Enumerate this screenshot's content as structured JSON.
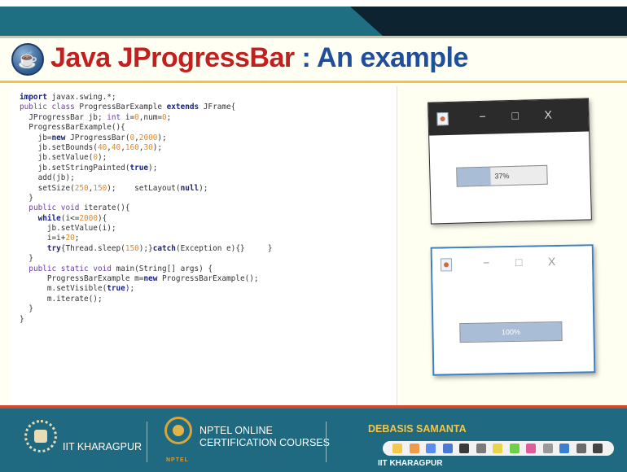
{
  "slide": {
    "title_part1": "Java JProgressBar",
    "title_part2": " : An example"
  },
  "code_lines": [
    [
      {
        "t": "import",
        "c": "kw"
      },
      {
        "t": " javax.swing.*;"
      }
    ],
    [
      {
        "t": "public class",
        "c": "kp"
      },
      {
        "t": " ProgressBarExample "
      },
      {
        "t": "extends",
        "c": "kw"
      },
      {
        "t": " JFrame{"
      }
    ],
    [
      {
        "t": "  JProgressBar jb; "
      },
      {
        "t": "int",
        "c": "kp"
      },
      {
        "t": " i="
      },
      {
        "t": "0",
        "c": "num"
      },
      {
        "t": ",num="
      },
      {
        "t": "0",
        "c": "num"
      },
      {
        "t": ";"
      }
    ],
    [
      {
        "t": "  ProgressBarExample(){"
      }
    ],
    [
      {
        "t": "    jb="
      },
      {
        "t": "new",
        "c": "kw"
      },
      {
        "t": " JProgressBar("
      },
      {
        "t": "0",
        "c": "num"
      },
      {
        "t": ","
      },
      {
        "t": "2000",
        "c": "num"
      },
      {
        "t": ");"
      }
    ],
    [
      {
        "t": "    jb.setBounds("
      },
      {
        "t": "40",
        "c": "num"
      },
      {
        "t": ","
      },
      {
        "t": "40",
        "c": "num"
      },
      {
        "t": ","
      },
      {
        "t": "160",
        "c": "num"
      },
      {
        "t": ","
      },
      {
        "t": "30",
        "c": "num"
      },
      {
        "t": ");"
      }
    ],
    [
      {
        "t": "    jb.setValue("
      },
      {
        "t": "0",
        "c": "num"
      },
      {
        "t": ");"
      }
    ],
    [
      {
        "t": "    jb.setStringPainted("
      },
      {
        "t": "true",
        "c": "kw"
      },
      {
        "t": ");"
      }
    ],
    [
      {
        "t": "    add(jb);"
      }
    ],
    [
      {
        "t": "    setSize("
      },
      {
        "t": "250",
        "c": "num"
      },
      {
        "t": ","
      },
      {
        "t": "150",
        "c": "num"
      },
      {
        "t": ");    setLayout("
      },
      {
        "t": "null",
        "c": "kw"
      },
      {
        "t": ");"
      }
    ],
    [
      {
        "t": "  }"
      }
    ],
    [
      {
        "t": "  "
      },
      {
        "t": "public void",
        "c": "kp"
      },
      {
        "t": " iterate(){"
      }
    ],
    [
      {
        "t": "    "
      },
      {
        "t": "while",
        "c": "kw"
      },
      {
        "t": "(i<="
      },
      {
        "t": "2000",
        "c": "num"
      },
      {
        "t": "){"
      }
    ],
    [
      {
        "t": "      jb.setValue(i);"
      }
    ],
    [
      {
        "t": "      i=i+"
      },
      {
        "t": "20",
        "c": "num"
      },
      {
        "t": ";"
      }
    ],
    [
      {
        "t": "      "
      },
      {
        "t": "try",
        "c": "kw"
      },
      {
        "t": "{Thread.sleep("
      },
      {
        "t": "150",
        "c": "num"
      },
      {
        "t": ");}"
      },
      {
        "t": "catch",
        "c": "kw"
      },
      {
        "t": "(Exception e){}     }"
      }
    ],
    [
      {
        "t": "  }"
      }
    ],
    [
      {
        "t": "  "
      },
      {
        "t": "public static void",
        "c": "kp"
      },
      {
        "t": " main(String[] args) {"
      }
    ],
    [
      {
        "t": "      ProgressBarExample m="
      },
      {
        "t": "new",
        "c": "kw"
      },
      {
        "t": " ProgressBarExample();"
      }
    ],
    [
      {
        "t": "      m.setVisible("
      },
      {
        "t": "true",
        "c": "kw"
      },
      {
        "t": ");"
      }
    ],
    [
      {
        "t": "      m.iterate();"
      }
    ],
    [
      {
        "t": "  }"
      }
    ],
    [
      {
        "t": "}"
      }
    ]
  ],
  "window1": {
    "minimize": "−",
    "maximize": "□",
    "close": "X",
    "progress_text": "37%",
    "progress_fraction": 0.37
  },
  "window2": {
    "minimize": "−",
    "maximize": "□",
    "close": "X",
    "progress_text": "100%",
    "progress_fraction": 1.0
  },
  "footer": {
    "institute": "IIT KHARAGPUR",
    "nptel_line1": "NPTEL ONLINE",
    "nptel_line2": "CERTIFICATION COURSES",
    "nptel_small": "NPTEL",
    "presenter_name": "DEBASIS SAMANTA",
    "presenter_institute": "IIT KHARAGPUR"
  },
  "colors": {
    "title_red": "#c21f1f",
    "title_blue": "#1f4e9c",
    "footer_bg": "#1f6a80",
    "presenter": "#f1c64a",
    "progress_fill": "#a9bdd6"
  },
  "toolbar_tools": [
    {
      "icon": "pointer-icon",
      "color": "#f2c94c"
    },
    {
      "icon": "arrow-icon",
      "color": "#f2994a"
    },
    {
      "icon": "select-icon",
      "color": "#5b8def"
    },
    {
      "icon": "pen-icon",
      "color": "#4a7bd0"
    },
    {
      "icon": "eraser-icon",
      "color": "#3a3a3a"
    },
    {
      "icon": "shape-icon",
      "color": "#7a7a7a"
    },
    {
      "icon": "highlighter-icon",
      "color": "#e8d44d"
    },
    {
      "icon": "marker-icon",
      "color": "#6fcf4a"
    },
    {
      "icon": "brush-icon",
      "color": "#e05c9a"
    },
    {
      "icon": "line-icon",
      "color": "#9a9a9a"
    },
    {
      "icon": "color-icon",
      "color": "#3a7fd0"
    },
    {
      "icon": "grid-icon",
      "color": "#6a6a6a"
    },
    {
      "icon": "close-tool-icon",
      "color": "#444444"
    }
  ]
}
